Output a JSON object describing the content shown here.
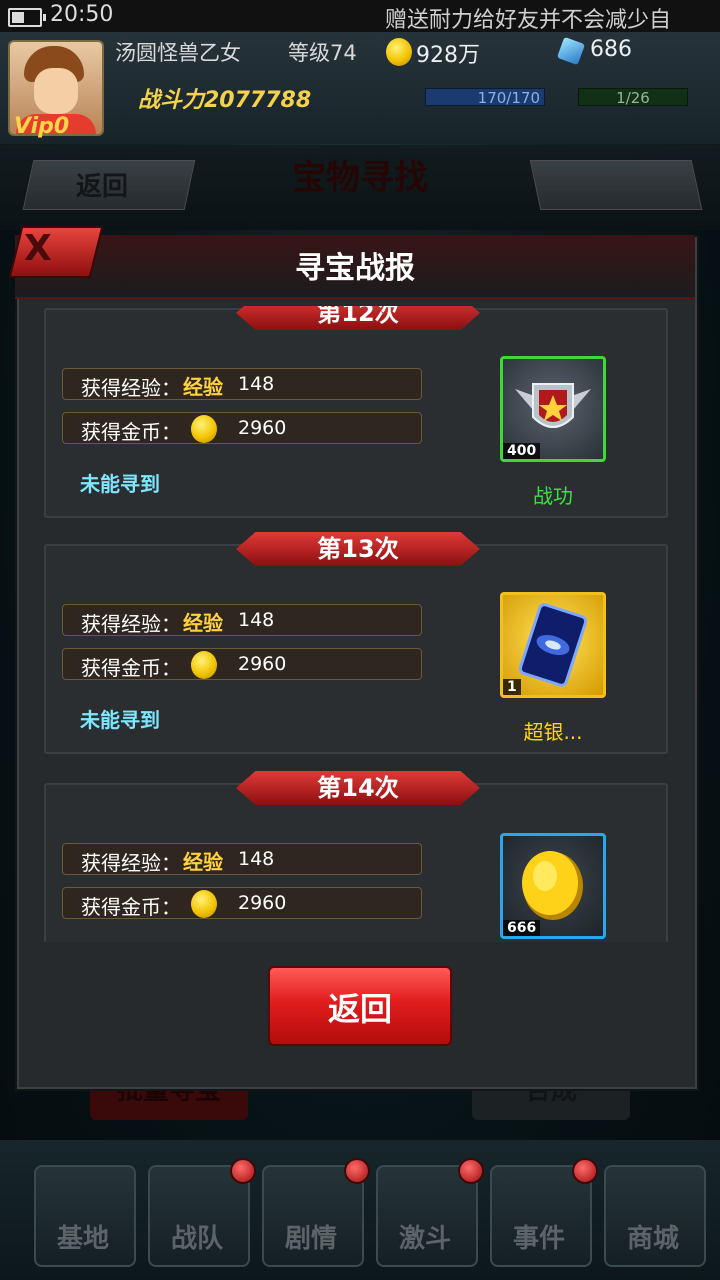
{
  "status_bar": {
    "time": "20:50",
    "ticker": "赠送耐力给好友并不会减少自"
  },
  "player": {
    "name": "汤圆怪兽乙女",
    "level": "等级74",
    "gold": "928万",
    "gems": "686",
    "power": "战斗力2077788",
    "vip": "Vip0",
    "stamina": "170/170",
    "energy": "1/26"
  },
  "page": {
    "back_label": "返回",
    "title": "宝物寻找"
  },
  "background_buttons": {
    "batch": "批量寻宝",
    "combine": "合成"
  },
  "bottom_nav": [
    {
      "label": "基地"
    },
    {
      "label": "战队"
    },
    {
      "label": "剧情"
    },
    {
      "label": "激斗"
    },
    {
      "label": "事件"
    },
    {
      "label": "商城"
    }
  ],
  "modal": {
    "title": "寻宝战报",
    "close_label": "X",
    "exp_label": "获得经验：",
    "exp_word": "经验",
    "gold_label": "获得金币：",
    "not_found": "未能寻到",
    "return_label": "返回",
    "reports": [
      {
        "round": "第12次",
        "exp": "148",
        "gold": "2960",
        "not_found": true,
        "item_qty": "400",
        "item_name": "战功",
        "item_name_color": "#37e23c",
        "frame_color": "#3fd73a",
        "item_icon": "medal-icon"
      },
      {
        "round": "第13次",
        "exp": "148",
        "gold": "2960",
        "not_found": true,
        "item_qty": "1",
        "item_name": "超银...",
        "item_name_color": "#ffd21a",
        "frame_color": "#f2c01c",
        "item_icon": "galaxy-card-icon"
      },
      {
        "round": "第14次",
        "exp": "148",
        "gold": "2960",
        "not_found": false,
        "item_qty": "666",
        "item_name": "",
        "item_name_color": "#ffffff",
        "frame_color": "#2aa6f0",
        "item_icon": "gold-coin-icon"
      }
    ]
  }
}
